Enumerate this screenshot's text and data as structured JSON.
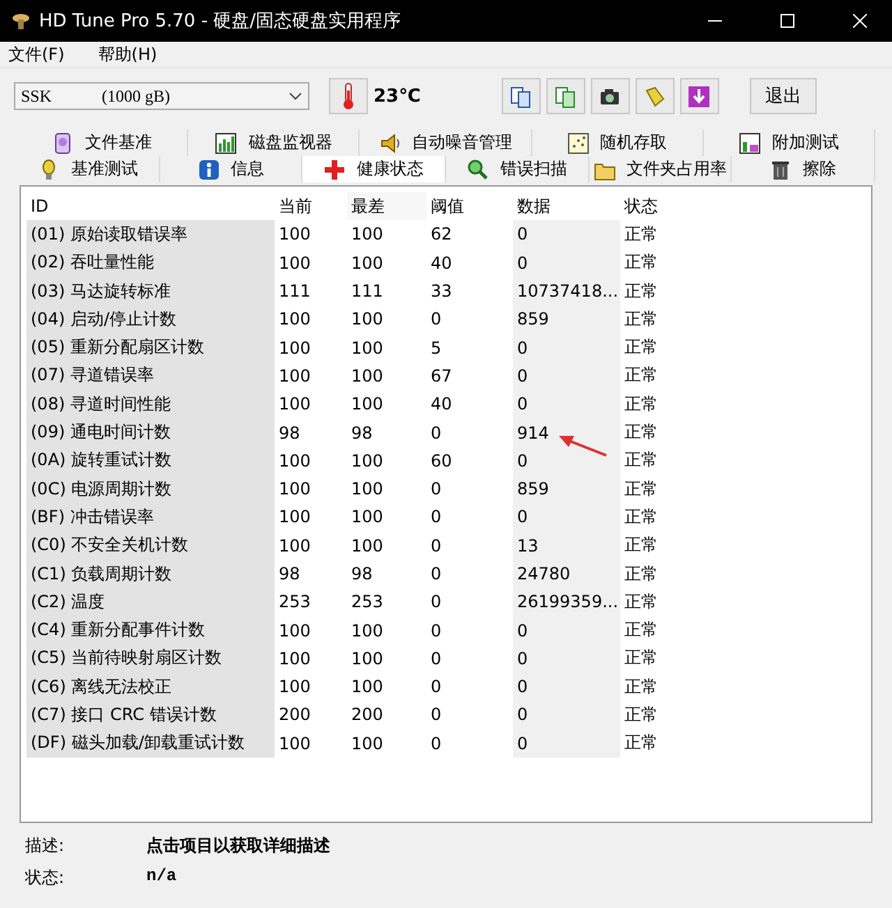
{
  "window": {
    "title": "HD Tune Pro 5.70 - 硬盘/固态硬盘实用程序"
  },
  "menu": [
    "文件(F)",
    "帮助(H)"
  ],
  "toolbar": {
    "drive": {
      "name": "SSK",
      "capacity": "(1000 gB)"
    },
    "temperature": "23℃",
    "exit_button": "退出"
  },
  "tab_rows": [
    [
      {
        "label": "文件基准",
        "selected": false
      },
      {
        "label": "磁盘监视器",
        "selected": false
      },
      {
        "label": "自动噪音管理",
        "selected": false
      },
      {
        "label": "随机存取",
        "selected": false
      },
      {
        "label": "附加测试",
        "selected": false
      }
    ],
    [
      {
        "label": "基准测试",
        "selected": false
      },
      {
        "label": "信息",
        "selected": false
      },
      {
        "label": "健康状态",
        "selected": true
      },
      {
        "label": "错误扫描",
        "selected": false
      },
      {
        "label": "文件夹占用率",
        "selected": false
      },
      {
        "label": "擦除",
        "selected": false
      }
    ]
  ],
  "table": {
    "columns": [
      "ID",
      "当前",
      "最差",
      "阈值",
      "数据",
      "状态"
    ],
    "rows": [
      [
        "(01) 原始读取错误率",
        "100",
        "100",
        "62",
        "0",
        "正常"
      ],
      [
        "(02) 吞吐量性能",
        "100",
        "100",
        "40",
        "0",
        "正常"
      ],
      [
        "(03) 马达旋转标准",
        "111",
        "111",
        "33",
        "10737418...",
        "正常"
      ],
      [
        "(04) 启动/停止计数",
        "100",
        "100",
        "0",
        "859",
        "正常"
      ],
      [
        "(05) 重新分配扇区计数",
        "100",
        "100",
        "5",
        "0",
        "正常"
      ],
      [
        "(07) 寻道错误率",
        "100",
        "100",
        "67",
        "0",
        "正常"
      ],
      [
        "(08) 寻道时间性能",
        "100",
        "100",
        "40",
        "0",
        "正常"
      ],
      [
        "(09) 通电时间计数",
        "98",
        "98",
        "0",
        "914",
        "正常"
      ],
      [
        "(0A) 旋转重试计数",
        "100",
        "100",
        "60",
        "0",
        "正常"
      ],
      [
        "(0C) 电源周期计数",
        "100",
        "100",
        "0",
        "859",
        "正常"
      ],
      [
        "(BF) 冲击错误率",
        "100",
        "100",
        "0",
        "0",
        "正常"
      ],
      [
        "(C0) 不安全关机计数",
        "100",
        "100",
        "0",
        "13",
        "正常"
      ],
      [
        "(C1) 负载周期计数",
        "98",
        "98",
        "0",
        "24780",
        "正常"
      ],
      [
        "(C2) 温度",
        "253",
        "253",
        "0",
        "26199359...",
        "正常"
      ],
      [
        "(C4) 重新分配事件计数",
        "100",
        "100",
        "0",
        "0",
        "正常"
      ],
      [
        "(C5) 当前待映射扇区计数",
        "100",
        "100",
        "0",
        "0",
        "正常"
      ],
      [
        "(C6) 离线无法校正",
        "100",
        "100",
        "0",
        "0",
        "正常"
      ],
      [
        "(C7) 接口 CRC 错误计数",
        "200",
        "200",
        "0",
        "0",
        "正常"
      ],
      [
        "(DF) 磁头加载/卸载重试计数",
        "100",
        "100",
        "0",
        "0",
        "正常"
      ]
    ]
  },
  "details": [
    {
      "label": "描述:",
      "value": "点击项目以获取详细描述"
    },
    {
      "label": "状态:",
      "value": "n/a"
    }
  ]
}
